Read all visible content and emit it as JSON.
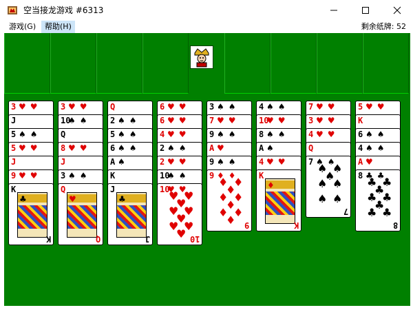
{
  "window": {
    "title": "空当接龙游戏 #6313",
    "app_icon": "freecell-app-icon",
    "buttons": [
      "minimize",
      "maximize",
      "close"
    ]
  },
  "menubar": {
    "game": "游戏(G)",
    "help": "帮助(H)",
    "cards_left": "剩余纸牌: 52"
  },
  "board": {
    "background": "#008000",
    "king_icon": "king-icon"
  },
  "columns": [
    {
      "cards": [
        {
          "rank": "3",
          "suit": "heart"
        },
        {
          "rank": "J",
          "suit": "spade"
        },
        {
          "rank": "5",
          "suit": "spade"
        },
        {
          "rank": "5",
          "suit": "heart"
        },
        {
          "rank": "J",
          "suit": "heart"
        },
        {
          "rank": "9",
          "suit": "heart"
        },
        {
          "rank": "K",
          "suit": "club"
        }
      ]
    },
    {
      "cards": [
        {
          "rank": "3",
          "suit": "heart"
        },
        {
          "rank": "10",
          "suit": "spade"
        },
        {
          "rank": "Q",
          "suit": "spade"
        },
        {
          "rank": "8",
          "suit": "heart"
        },
        {
          "rank": "J",
          "suit": "heart"
        },
        {
          "rank": "3",
          "suit": "spade"
        },
        {
          "rank": "Q",
          "suit": "heart"
        }
      ]
    },
    {
      "cards": [
        {
          "rank": "Q",
          "suit": "heart"
        },
        {
          "rank": "2",
          "suit": "spade"
        },
        {
          "rank": "5",
          "suit": "spade"
        },
        {
          "rank": "6",
          "suit": "spade"
        },
        {
          "rank": "A",
          "suit": "spade"
        },
        {
          "rank": "K",
          "suit": "spade"
        },
        {
          "rank": "J",
          "suit": "club"
        }
      ]
    },
    {
      "cards": [
        {
          "rank": "6",
          "suit": "heart"
        },
        {
          "rank": "6",
          "suit": "heart"
        },
        {
          "rank": "4",
          "suit": "heart"
        },
        {
          "rank": "2",
          "suit": "spade"
        },
        {
          "rank": "2",
          "suit": "heart"
        },
        {
          "rank": "10",
          "suit": "spade"
        },
        {
          "rank": "10",
          "suit": "heart"
        }
      ]
    },
    {
      "cards": [
        {
          "rank": "3",
          "suit": "spade"
        },
        {
          "rank": "7",
          "suit": "heart"
        },
        {
          "rank": "9",
          "suit": "spade"
        },
        {
          "rank": "A",
          "suit": "heart"
        },
        {
          "rank": "9",
          "suit": "spade"
        },
        {
          "rank": "9",
          "suit": "diamond"
        }
      ]
    },
    {
      "cards": [
        {
          "rank": "4",
          "suit": "spade"
        },
        {
          "rank": "10",
          "suit": "heart"
        },
        {
          "rank": "8",
          "suit": "spade"
        },
        {
          "rank": "A",
          "suit": "spade"
        },
        {
          "rank": "4",
          "suit": "heart"
        },
        {
          "rank": "K",
          "suit": "diamond"
        }
      ]
    },
    {
      "cards": [
        {
          "rank": "7",
          "suit": "heart"
        },
        {
          "rank": "3",
          "suit": "heart"
        },
        {
          "rank": "4",
          "suit": "heart"
        },
        {
          "rank": "Q",
          "suit": "heart"
        },
        {
          "rank": "7",
          "suit": "spade"
        }
      ]
    },
    {
      "cards": [
        {
          "rank": "5",
          "suit": "heart"
        },
        {
          "rank": "K",
          "suit": "heart"
        },
        {
          "rank": "6",
          "suit": "spade"
        },
        {
          "rank": "4",
          "suit": "spade"
        },
        {
          "rank": "A",
          "suit": "heart"
        },
        {
          "rank": "8",
          "suit": "club"
        }
      ]
    }
  ]
}
